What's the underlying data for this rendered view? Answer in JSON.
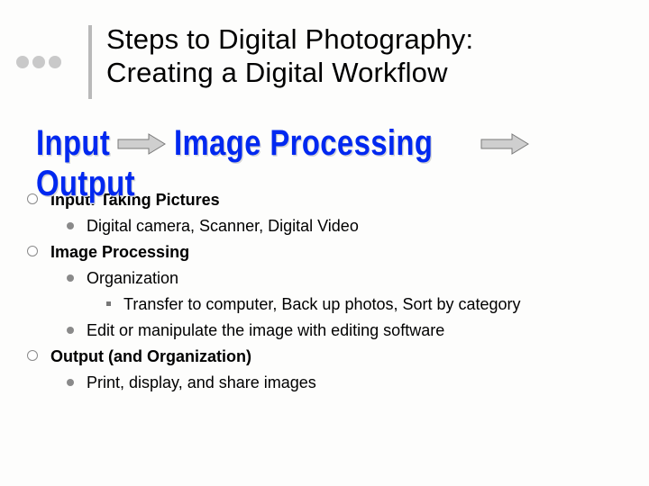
{
  "title_line1": "Steps to Digital Photography:",
  "title_line2": "Creating a Digital Workflow",
  "flow": {
    "input": "Input",
    "processing": "Image Processing",
    "output": "Output"
  },
  "b1": "Input: Taking Pictures",
  "b1_1": "Digital camera, Scanner, Digital Video",
  "b2": "Image Processing",
  "b2_1": "Organization",
  "b2_1_1": "Transfer to computer, Back up photos, Sort by category",
  "b2_2": "Edit or manipulate the image with editing software",
  "b3": "Output (and Organization)",
  "b3_1": "Print, display, and share images"
}
